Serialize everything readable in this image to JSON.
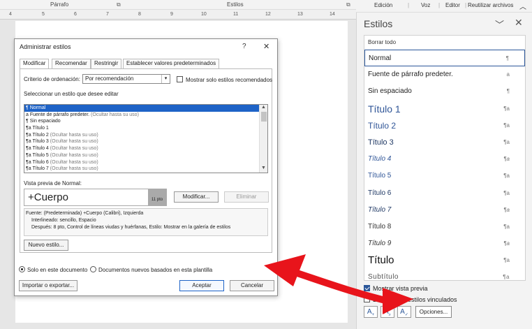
{
  "ribbon": {
    "groups": [
      "Párrafo",
      "Estilos"
    ],
    "right_tabs": [
      "Edición",
      "Voz",
      "Editor",
      "Reutilizar archivos"
    ],
    "collapse_icon": "chevron-up-icon"
  },
  "ruler": {
    "ticks": [
      "4",
      "5",
      "6",
      "7",
      "8",
      "9",
      "10",
      "11",
      "12",
      "13",
      "14"
    ]
  },
  "dialog": {
    "title": "Administrar estilos",
    "help": "?",
    "tabs": [
      "Modificar",
      "Recomendar",
      "Restringir",
      "Establecer valores predeterminados"
    ],
    "sort_label": "Criterio de ordenación:",
    "sort_value": "Por recomendación",
    "show_recommended_label": "Mostrar solo estilos recomendados",
    "select_label": "Seleccionar un estilo que desee editar",
    "styles": [
      {
        "mark": "¶",
        "name": "Normal",
        "note": ""
      },
      {
        "mark": "a",
        "name": "Fuente de párrafo predeter.",
        "note": "(Ocultar hasta su uso)"
      },
      {
        "mark": "¶",
        "name": "Sin espaciado",
        "note": ""
      },
      {
        "mark": "¶a",
        "name": "Título 1",
        "note": ""
      },
      {
        "mark": "¶a",
        "name": "Título 2",
        "note": "(Ocultar hasta su uso)"
      },
      {
        "mark": "¶a",
        "name": "Título 3",
        "note": "(Ocultar hasta su uso)"
      },
      {
        "mark": "¶a",
        "name": "Título 4",
        "note": "(Ocultar hasta su uso)"
      },
      {
        "mark": "¶a",
        "name": "Título 5",
        "note": "(Ocultar hasta su uso)"
      },
      {
        "mark": "¶a",
        "name": "Título 6",
        "note": "(Ocultar hasta su uso)"
      },
      {
        "mark": "¶a",
        "name": "Título 7",
        "note": "(Ocultar hasta su uso)"
      }
    ],
    "preview_label": "Vista previa de Normal:",
    "preview_text": "+Cuerpo",
    "preview_size": "11 pto",
    "modify_button": "Modificar...",
    "delete_button": "Eliminar",
    "description": [
      "Fuente: (Predeterminada) +Cuerpo (Calibri), Izquierda",
      "Interlineado:  sencillo, Espacio",
      "Después:  8 pto, Control de líneas viudas y huérfanas, Estilo: Mostrar en la galería de estilos"
    ],
    "new_style_button": "Nuevo estilo...",
    "radio_this_doc": "Solo en este documento",
    "radio_new_docs": "Documentos nuevos basados en esta plantilla",
    "import_export_button": "Importar o exportar...",
    "accept_button": "Aceptar",
    "cancel_button": "Cancelar"
  },
  "pane": {
    "title": "Estilos",
    "clear_all": "Borrar todo",
    "styles": [
      {
        "name": "Normal",
        "mark": "¶"
      },
      {
        "name": "Fuente de párrafo predeter.",
        "mark": "a"
      },
      {
        "name": "Sin espaciado",
        "mark": "¶"
      },
      {
        "name": "Título 1",
        "mark": "¶a"
      },
      {
        "name": "Título 2",
        "mark": "¶a"
      },
      {
        "name": "Título 3",
        "mark": "¶a"
      },
      {
        "name": "Título 4",
        "mark": "¶a"
      },
      {
        "name": "Título 5",
        "mark": "¶a"
      },
      {
        "name": "Título 6",
        "mark": "¶a"
      },
      {
        "name": "Título 7",
        "mark": "¶a"
      },
      {
        "name": "Título 8",
        "mark": "¶a"
      },
      {
        "name": "Título 9",
        "mark": "¶a"
      },
      {
        "name": "Título",
        "mark": "¶a"
      },
      {
        "name": "Subtítulo",
        "mark": "¶a"
      }
    ],
    "show_preview": "Mostrar vista previa",
    "disable_linked": "Deshabilitar estilos vinculados",
    "options_button": "Opciones..."
  },
  "colors": {
    "accent": "#2b579a",
    "selection": "#1e63c7",
    "arrow": "#e8141b"
  }
}
